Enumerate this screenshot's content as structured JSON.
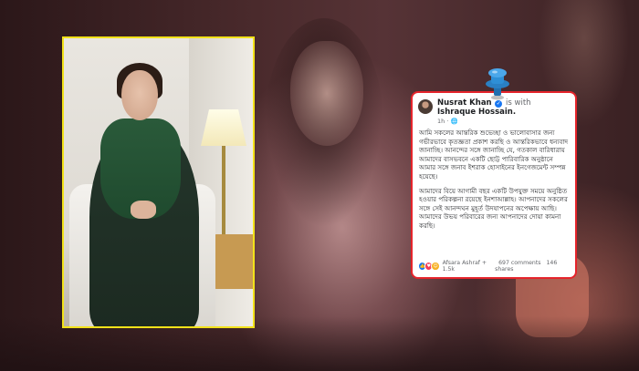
{
  "post": {
    "author": "Nusrat Khan",
    "with_word": "is with",
    "tagged": "Ishraque Hossain.",
    "meta": "1h · ",
    "paragraph_1": "আমি সকলের আন্তরিক শুভেচ্ছা ও ভালোবাসার জন্য গভীরভাবে কৃতজ্ঞতা প্রকাশ করছি ও আন্তরিকভাবে ধন্যবাদ জানাচ্ছি। আনন্দের সঙ্গে জানাচ্ছি যে, গতকাল বারিধারায় আমাদের বাসভবনে একটি ছোট্ট পারিবারিক অনুষ্ঠানে আমার সঙ্গে জনাব ইশরাক হোসাইনের ইনগেজমেন্ট সম্পন্ন হয়েছে।",
    "paragraph_2": "আমাদের বিয়ে আগামী বছর একটি উপযুক্ত সময়ে অনুষ্ঠিত হওয়ার পরিকল্পনা রয়েছে ইনশাআল্লাহ। আপনাদের সকলের সঙ্গে সেই আনন্দঘন মুহূর্ত উদযাপনের অপেক্ষায় আছি। আমাদের উভয় পরিবারের জন্য আপনাদের দোয়া কামনা করছি।",
    "reactors": "Afsara Ashraf + 1.5k",
    "comments": "697 comments",
    "shares": "146 shares"
  },
  "colors": {
    "post_border": "#e5242b",
    "photo_border": "#f2e21a",
    "pin": "#2e8fd6"
  },
  "icons": [
    "verified-badge-icon",
    "globe-icon",
    "like-icon",
    "love-icon",
    "care-icon",
    "push-pin-icon"
  ]
}
